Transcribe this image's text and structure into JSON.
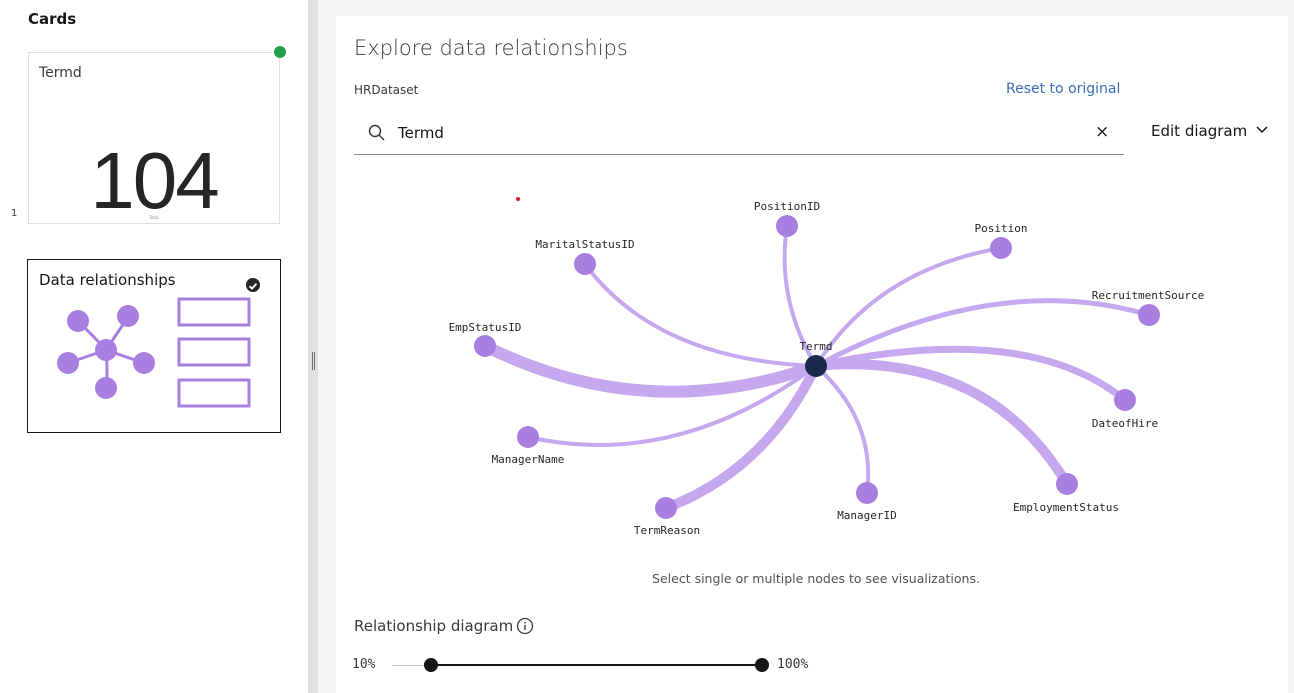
{
  "sidebar": {
    "title": "Cards",
    "cards": [
      {
        "title": "Termd",
        "value": "104",
        "sublabel": "Total",
        "index": "1",
        "status_color": "#24a148"
      },
      {
        "title": "Data relationships",
        "selected": true
      }
    ]
  },
  "main": {
    "title": "Explore data relationships",
    "dataset": "HRDataset",
    "reset_label": "Reset to original",
    "search": {
      "value": "Termd",
      "icon": "search-icon",
      "clear_icon": "close-icon"
    },
    "edit_diagram_label": "Edit diagram",
    "diagram": {
      "center": "Termd",
      "nodes": [
        "PositionID",
        "Position",
        "MaritalStatusID",
        "RecruitmentSource",
        "EmpStatusID",
        "DateofHire",
        "ManagerName",
        "EmploymentStatus",
        "ManagerID",
        "TermReason"
      ],
      "node_color": "#a77fe0",
      "center_color": "#1b2a4a"
    },
    "hint": "Select single or multiple nodes to see visualizations.",
    "relationship_label": "Relationship diagram",
    "slider": {
      "min_label": "10%",
      "max_label": "100%",
      "low": 10,
      "high": 100
    }
  }
}
